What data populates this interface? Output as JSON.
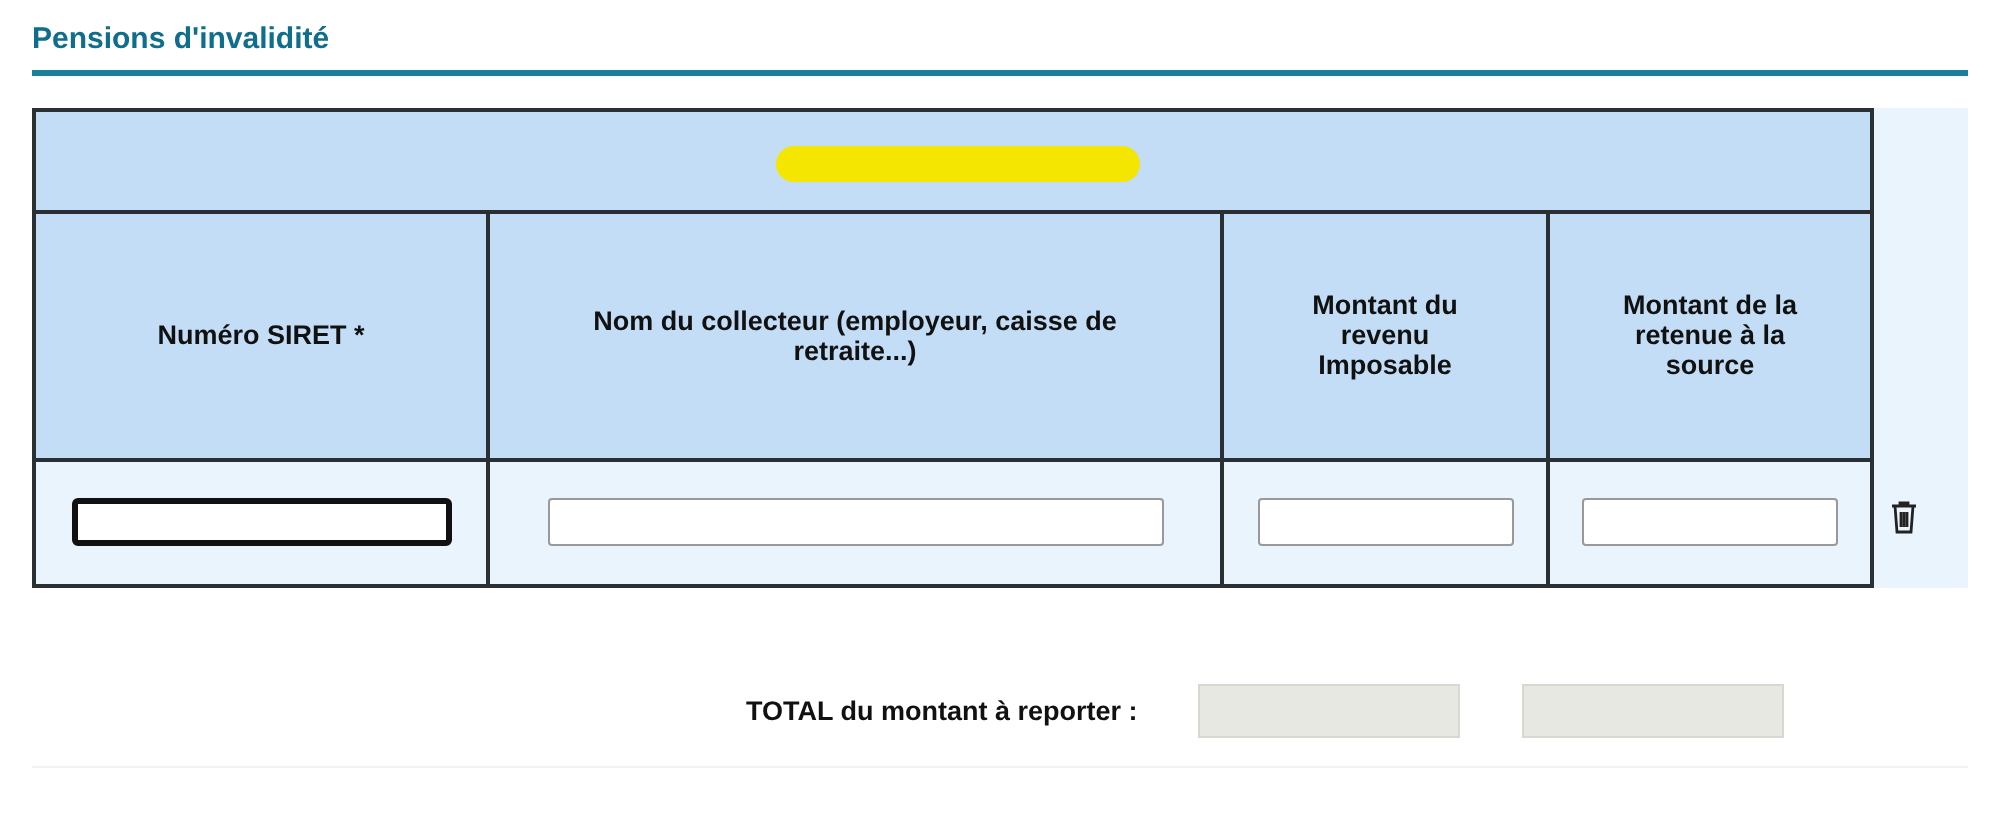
{
  "section": {
    "title": "Pensions d'invalidité"
  },
  "table": {
    "columns": [
      "Numéro SIRET *",
      "Nom du collecteur (employeur, caisse de retraite...)",
      "Montant du revenu Imposable",
      "Montant de la retenue à la source"
    ],
    "rows": [
      {
        "fields": [
          {
            "focused": true
          },
          {
            "focused": false
          },
          {
            "focused": false
          },
          {
            "focused": false
          }
        ]
      }
    ]
  },
  "total": {
    "label": "TOTAL du montant à reporter :",
    "fields": [
      {
        "disabled": true
      },
      {
        "disabled": true
      }
    ]
  }
}
